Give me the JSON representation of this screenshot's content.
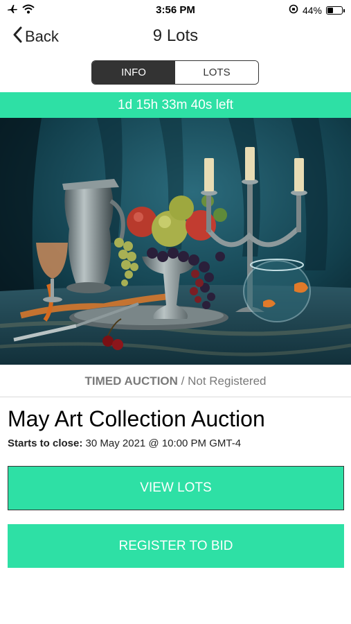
{
  "status_bar": {
    "time": "3:56 PM",
    "battery_percent": "44%",
    "battery_level": 0.44,
    "icons": [
      "airplane-icon",
      "wifi-icon",
      "orientation-lock-icon",
      "battery-icon"
    ]
  },
  "nav": {
    "back_label": "Back",
    "title": "9 Lots"
  },
  "tabs": [
    {
      "label": "INFO",
      "active": true
    },
    {
      "label": "LOTS",
      "active": false
    }
  ],
  "countdown": "1d 15h 33m 40s left",
  "auction": {
    "type": "TIMED AUCTION",
    "separator": " / ",
    "registration_status": "Not Registered",
    "title": "May Art Collection Auction",
    "close_label": "Starts to close:",
    "close_value": " 30 May 2021 @ 10:00 PM GMT-4"
  },
  "buttons": {
    "view_lots": "VIEW LOTS",
    "register": "REGISTER TO BID"
  },
  "colors": {
    "accent": "#2ee0a5",
    "dark": "#333333",
    "muted_text": "#7a7a7a"
  }
}
